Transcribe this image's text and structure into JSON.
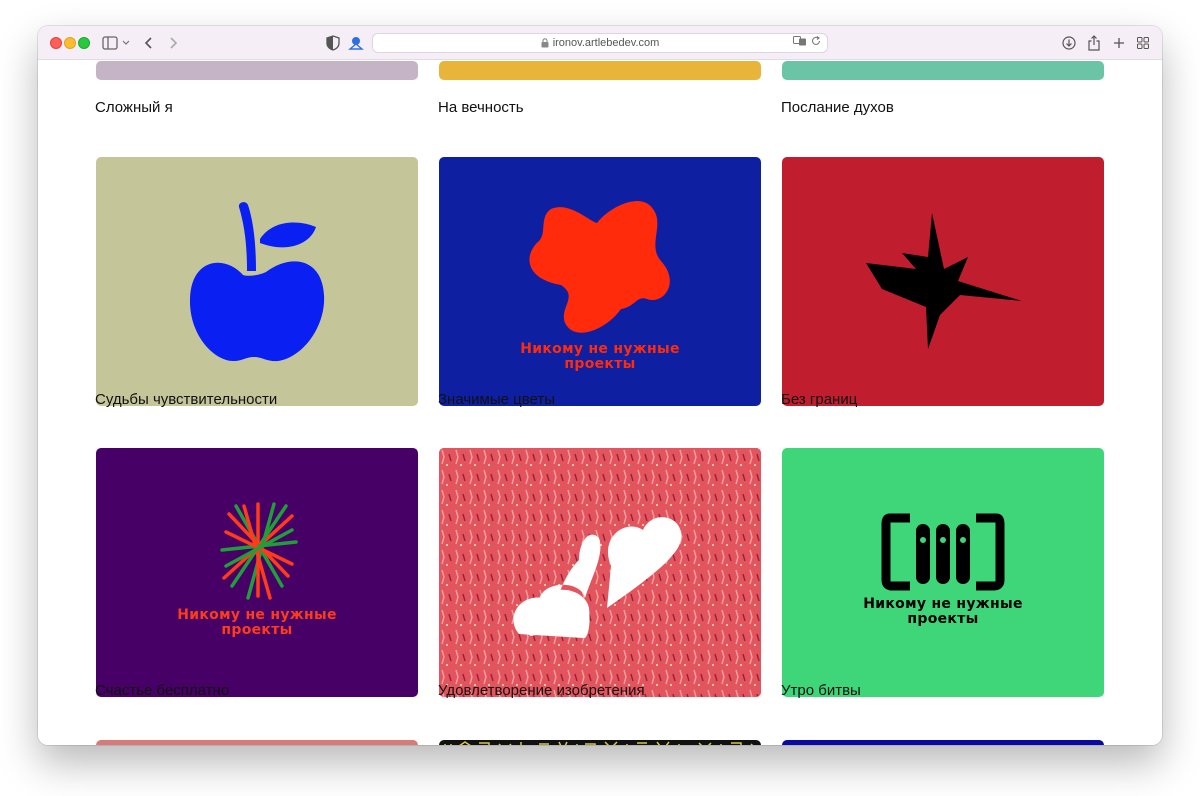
{
  "browser": {
    "url": "ironov.artlebedev.com"
  },
  "rows": [
    {
      "items": [
        {
          "title": "Сложный я",
          "color": "#c4b4c6"
        },
        {
          "title": "На вечность",
          "color": "#e8b53a"
        },
        {
          "title": "Послание духов",
          "color": "#6cc4a6"
        }
      ]
    },
    {
      "items": [
        {
          "title": "Судьбы чувствительности",
          "color": "#c5c59a",
          "icon": "apple-icon"
        },
        {
          "title": "Значимые цветы",
          "color": "#0f1fa1",
          "icon": "flower-icon",
          "overlay_text_1": "Никому не нужные",
          "overlay_text_2": "проекты"
        },
        {
          "title": "Без границ",
          "color": "#c01e2e",
          "icon": "star-icon"
        }
      ]
    },
    {
      "items": [
        {
          "title": "Счастье бесплатно",
          "color": "#470066",
          "icon": "crossed-lines-icon",
          "overlay_text_1": "Никому не нужные",
          "overlay_text_2": "проекты"
        },
        {
          "title": "Удовлетворение изобретения",
          "color": "#e2545e",
          "icon": "hearts-icon"
        },
        {
          "title": "Утро битвы",
          "color": "#3fd67a",
          "icon": "logo-icon",
          "overlay_text_1": "Никому не нужные",
          "overlay_text_2": "проекты"
        }
      ]
    },
    {
      "items": [
        {
          "color": "#d67a7a"
        },
        {
          "color": "#111111"
        },
        {
          "color": "#0a0aa3"
        }
      ]
    }
  ]
}
